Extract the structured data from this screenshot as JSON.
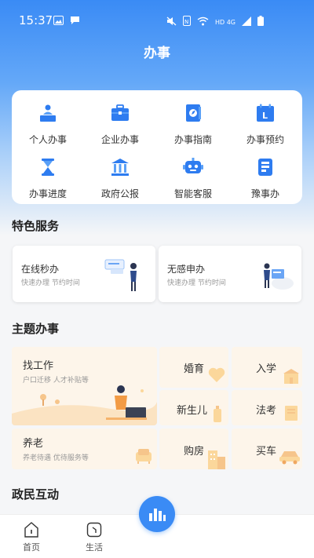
{
  "status_bar": {
    "time": "15:37",
    "network": "HD 4G"
  },
  "page_title": "办事",
  "services": [
    {
      "label": "个人办事",
      "icon": "person-desk-icon"
    },
    {
      "label": "企业办事",
      "icon": "briefcase-icon"
    },
    {
      "label": "办事指南",
      "icon": "guide-book-icon"
    },
    {
      "label": "办事预约",
      "icon": "calendar-icon"
    },
    {
      "label": "办事进度",
      "icon": "hourglass-icon"
    },
    {
      "label": "政府公报",
      "icon": "government-building-icon"
    },
    {
      "label": "智能客服",
      "icon": "robot-icon"
    },
    {
      "label": "豫事办",
      "icon": "yushiban-icon"
    }
  ],
  "featured": {
    "title": "特色服务",
    "items": [
      {
        "title": "在线秒办",
        "subtitle": "快速办理 节约时间"
      },
      {
        "title": "无感申办",
        "subtitle": "快速办理 节约时间"
      }
    ]
  },
  "themes": {
    "title": "主题办事",
    "job": {
      "title": "找工作",
      "subtitle": "户口迁移 人才补贴等"
    },
    "pension": {
      "title": "养老",
      "subtitle": "养老待遇 优待服务等"
    },
    "marriage": "婚育",
    "school": "入学",
    "newborn": "新生儿",
    "law": "法考",
    "housing": "购房",
    "car": "买车"
  },
  "interaction_title": "政民互动",
  "bottom_nav": [
    {
      "label": "首页",
      "icon": "home-icon"
    },
    {
      "label": "生活",
      "icon": "life-icon"
    }
  ],
  "colors": {
    "primary": "#3a8bf5",
    "theme_bg": "#fdf5ea"
  }
}
